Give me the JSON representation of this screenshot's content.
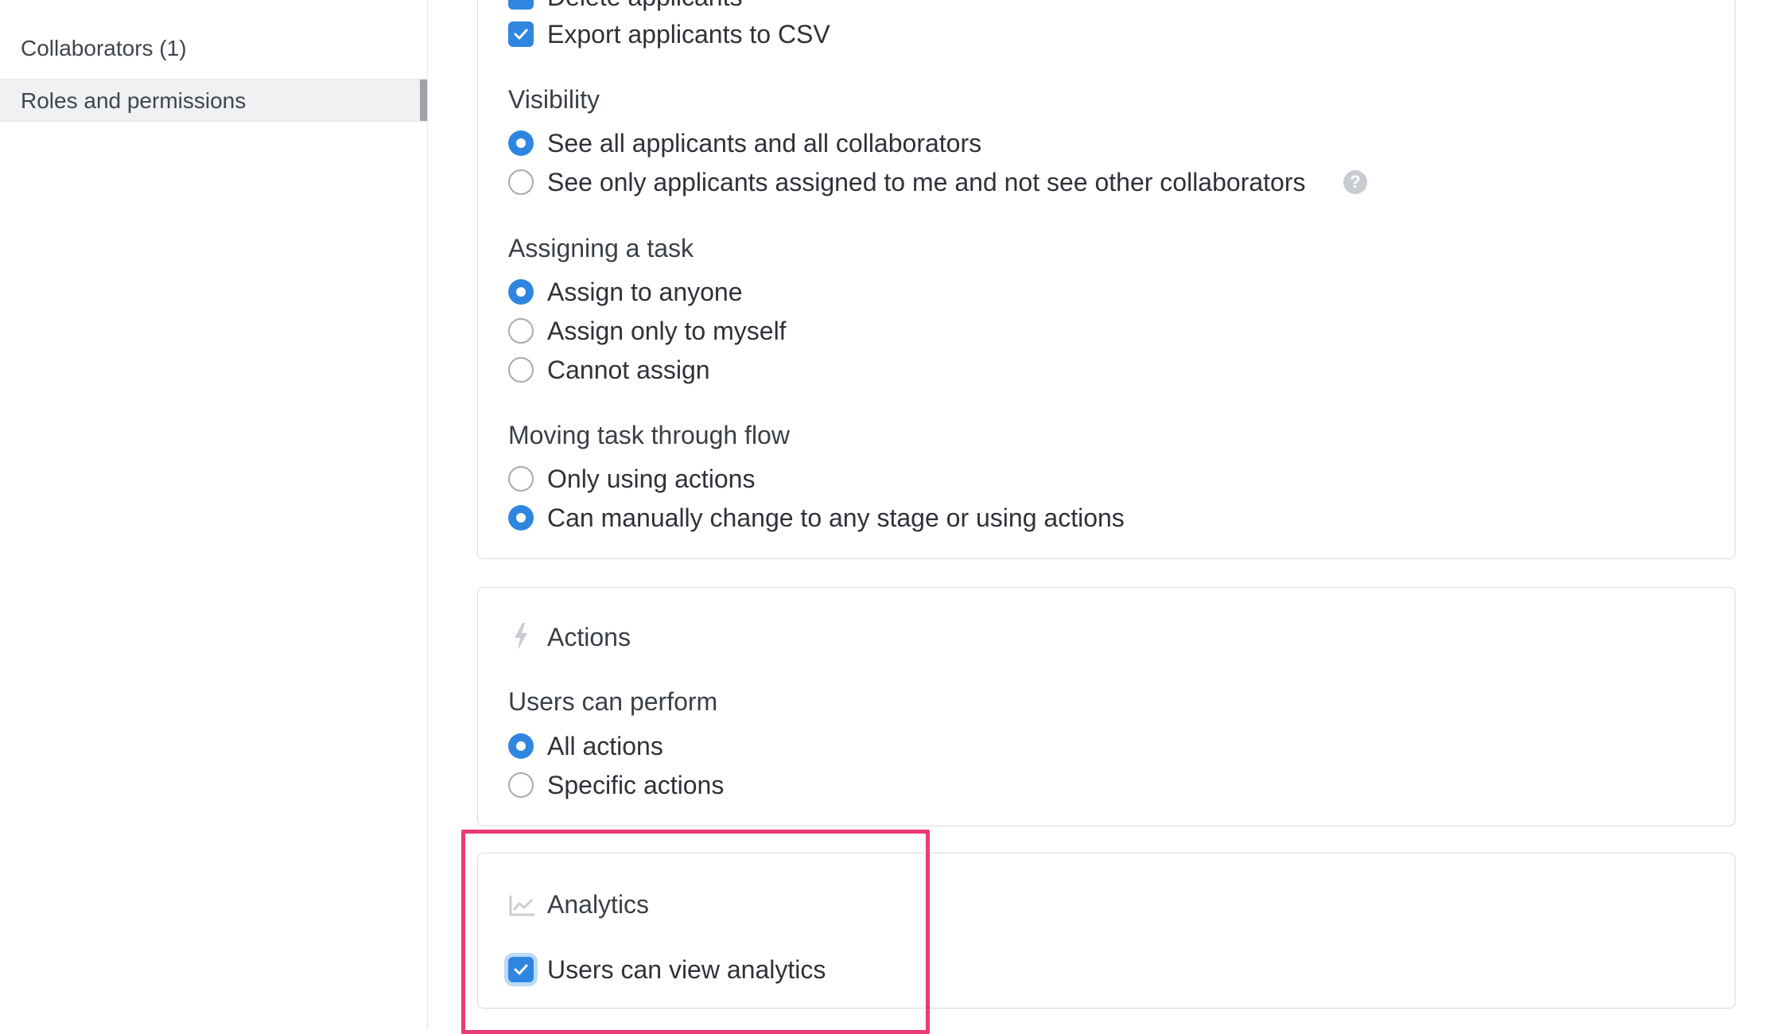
{
  "sidebar": {
    "items": [
      {
        "label": "Collaborators (1)"
      },
      {
        "label": "Roles and permissions"
      }
    ]
  },
  "permissions": {
    "partial_checkbox_label": "Delete applicants",
    "export_label": "Export applicants to CSV",
    "visibility": {
      "heading": "Visibility",
      "options": [
        {
          "label": "See all applicants and all collaborators",
          "selected": true
        },
        {
          "label": "See only applicants assigned to me and not see other collaborators",
          "selected": false
        }
      ],
      "help_icon": "question-circle-icon"
    },
    "assigning": {
      "heading": "Assigning a task",
      "options": [
        {
          "label": "Assign to anyone",
          "selected": true
        },
        {
          "label": "Assign only to myself",
          "selected": false
        },
        {
          "label": "Cannot assign",
          "selected": false
        }
      ]
    },
    "moving": {
      "heading": "Moving task through flow",
      "options": [
        {
          "label": "Only using actions",
          "selected": false
        },
        {
          "label": "Can manually change to any stage or using actions",
          "selected": true
        }
      ]
    }
  },
  "actions": {
    "icon": "lightning-icon",
    "title": "Actions",
    "heading": "Users can perform",
    "options": [
      {
        "label": "All actions",
        "selected": true
      },
      {
        "label": "Specific actions",
        "selected": false
      }
    ]
  },
  "analytics": {
    "icon": "chart-icon",
    "title": "Analytics",
    "checkbox_label": "Users can view analytics",
    "checked": true
  },
  "colors": {
    "accent": "#2f86e0",
    "highlight": "#ec3a74"
  }
}
